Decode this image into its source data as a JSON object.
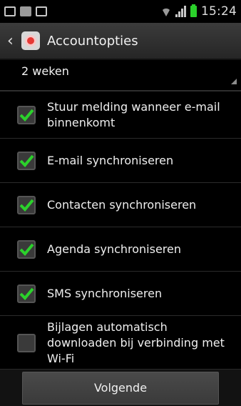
{
  "status_bar": {
    "time": "15:24",
    "icons": [
      "usb-icon",
      "sd-card-icon",
      "image-icon",
      "wifi-icon",
      "signal-icon",
      "battery-icon"
    ]
  },
  "action_bar": {
    "title": "Accountopties",
    "back_icon": "chevron-left-icon",
    "app_icon": "email-app-icon"
  },
  "dropdown": {
    "value": "2 weken"
  },
  "options": [
    {
      "label": "Stuur melding wanneer e-mail binnenkomt",
      "checked": true
    },
    {
      "label": "E-mail synchroniseren",
      "checked": true
    },
    {
      "label": "Contacten synchroniseren",
      "checked": true
    },
    {
      "label": "Agenda synchroniseren",
      "checked": true
    },
    {
      "label": "SMS synchroniseren",
      "checked": true
    },
    {
      "label": "Bijlagen automatisch downloaden bij verbinding met Wi-Fi",
      "checked": false
    }
  ],
  "footer": {
    "next_label": "Volgende"
  },
  "colors": {
    "check": "#2bd12b",
    "background": "#000000"
  }
}
